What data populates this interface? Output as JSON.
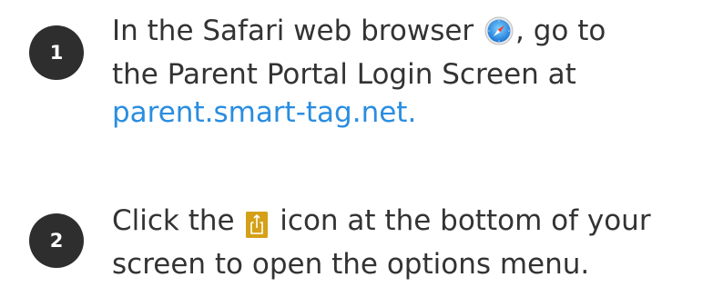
{
  "steps": [
    {
      "number": "1",
      "line1_before_icon": "In the Safari web browser ",
      "line1_after_icon": ", go to",
      "line2": "the Parent Portal Login Screen at",
      "link": "parent.smart-tag.net.",
      "icon": "safari-compass-icon"
    },
    {
      "number": "2",
      "line1_before_icon": "Click the ",
      "line1_after_icon": " icon at the bottom of your",
      "line2": "screen to open the options menu.",
      "icon": "share-icon"
    }
  ],
  "colors": {
    "text": "#333333",
    "badge": "#2e2e2e",
    "link": "#2a8de0",
    "share_icon": "#d4a017"
  }
}
